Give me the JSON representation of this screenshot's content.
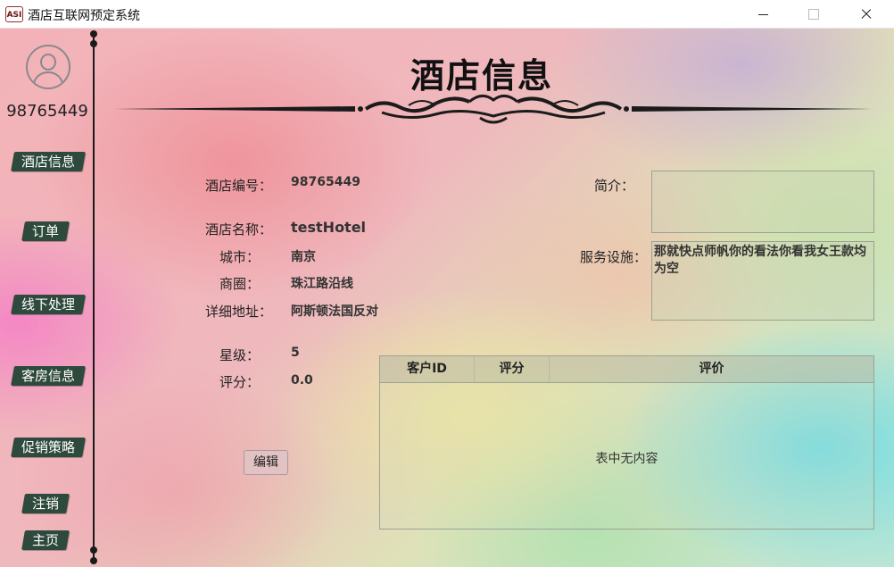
{
  "window": {
    "icon_text": "ASI",
    "title": "酒店互联网预定系统"
  },
  "sidebar": {
    "user_id": "98765449",
    "items": [
      {
        "label": "酒店信息"
      },
      {
        "label": "订单"
      },
      {
        "label": "线下处理"
      },
      {
        "label": "客房信息"
      },
      {
        "label": "促销策略"
      },
      {
        "label": "注销"
      },
      {
        "label": "主页"
      }
    ]
  },
  "header": {
    "title": "酒店信息"
  },
  "hotel": {
    "id_label": "酒店编号：",
    "id_value": "98765449",
    "name_label": "酒店名称：",
    "name_value": "testHotel",
    "city_label": "城市：",
    "city_value": "南京",
    "district_label": "商圈：",
    "district_value": "珠江路沿线",
    "address_label": "详细地址：",
    "address_value": "阿斯顿法国反对",
    "star_label": "星级：",
    "star_value": "5",
    "rating_label": "评分：",
    "rating_value": "0.0",
    "intro_label": "简介：",
    "intro_value": "",
    "facilities_label": "服务设施：",
    "facilities_value": "那就快点师帆你的看法你看我女王款均为空"
  },
  "edit_button": "编辑",
  "reviews_table": {
    "columns": [
      "客户ID",
      "评分",
      "评价"
    ],
    "rows": [],
    "empty_text": "表中无内容"
  },
  "colors": {
    "nav_button": "#2e4a3c",
    "separator": "#1b1b1b"
  }
}
